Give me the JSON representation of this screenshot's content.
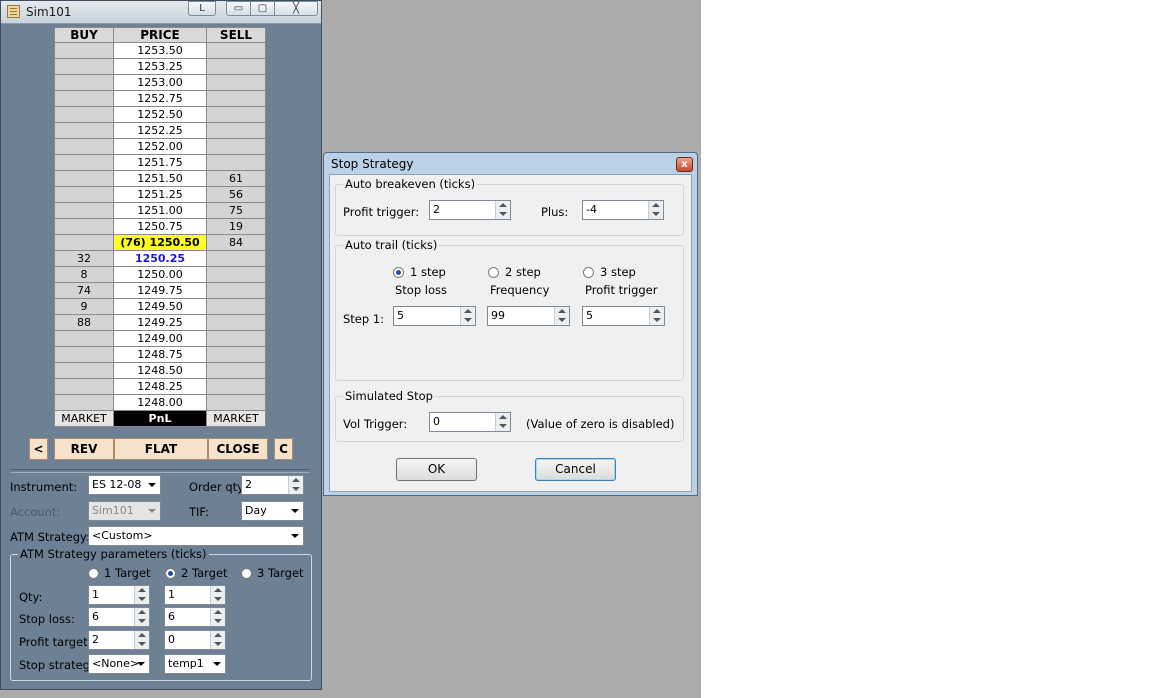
{
  "main_window": {
    "title": "Sim101",
    "title_buttons": {
      "layout": "L",
      "minimize": "▭",
      "maximize": "▢",
      "close": "╳"
    },
    "ladder": {
      "headers": {
        "buy": "BUY",
        "price": "PRICE",
        "sell": "SELL"
      },
      "rows": [
        {
          "buy": "",
          "price": "1253.50",
          "sell": ""
        },
        {
          "buy": "",
          "price": "1253.25",
          "sell": ""
        },
        {
          "buy": "",
          "price": "1253.00",
          "sell": ""
        },
        {
          "buy": "",
          "price": "1252.75",
          "sell": ""
        },
        {
          "buy": "",
          "price": "1252.50",
          "sell": ""
        },
        {
          "buy": "",
          "price": "1252.25",
          "sell": ""
        },
        {
          "buy": "",
          "price": "1252.00",
          "sell": ""
        },
        {
          "buy": "",
          "price": "1251.75",
          "sell": ""
        },
        {
          "buy": "",
          "price": "1251.50",
          "sell": "61"
        },
        {
          "buy": "",
          "price": "1251.25",
          "sell": "56"
        },
        {
          "buy": "",
          "price": "1251.00",
          "sell": "75"
        },
        {
          "buy": "",
          "price": "1250.75",
          "sell": "19"
        },
        {
          "buy": "",
          "price": "(76) 1250.50",
          "sell": "84",
          "style": "highlight"
        },
        {
          "buy": "32",
          "price": "1250.25",
          "sell": "",
          "style": "last"
        },
        {
          "buy": "8",
          "price": "1250.00",
          "sell": ""
        },
        {
          "buy": "74",
          "price": "1249.75",
          "sell": ""
        },
        {
          "buy": "9",
          "price": "1249.50",
          "sell": ""
        },
        {
          "buy": "88",
          "price": "1249.25",
          "sell": ""
        },
        {
          "buy": "",
          "price": "1249.00",
          "sell": ""
        },
        {
          "buy": "",
          "price": "1248.75",
          "sell": ""
        },
        {
          "buy": "",
          "price": "1248.50",
          "sell": ""
        },
        {
          "buy": "",
          "price": "1248.25",
          "sell": ""
        },
        {
          "buy": "",
          "price": "1248.00",
          "sell": ""
        }
      ],
      "footer": {
        "buy_market": "MARKET",
        "pnl": "PnL",
        "sell_market": "MARKET"
      }
    },
    "action_buttons": {
      "left": "<",
      "rev": "REV",
      "flat": "FLAT",
      "close": "CLOSE",
      "right": "C"
    },
    "form": {
      "instrument_label": "Instrument:",
      "instrument_value": "ES 12-08",
      "order_qty_label": "Order qty:",
      "order_qty_value": "2",
      "account_label": "Account:",
      "account_value": "Sim101",
      "tif_label": "TIF:",
      "tif_value": "Day",
      "atm_label": "ATM Strategy:",
      "atm_value": "<Custom>"
    },
    "atm_params": {
      "title": "ATM Strategy parameters (ticks)",
      "target_options": [
        "1 Target",
        "2 Target",
        "3 Target"
      ],
      "selected_target": 1,
      "qty_label": "Qty:",
      "qty_values": [
        "1",
        "1"
      ],
      "stop_loss_label": "Stop loss:",
      "stop_loss_values": [
        "6",
        "6"
      ],
      "profit_target_label": "Profit target:",
      "profit_target_values": [
        "2",
        "0"
      ],
      "stop_strategy_label": "Stop strategy:",
      "stop_strategy_values": [
        "<None>",
        "temp1"
      ]
    }
  },
  "stop_dialog": {
    "title": "Stop Strategy",
    "close_glyph": "x",
    "auto_breakeven": {
      "title": "Auto breakeven (ticks)",
      "profit_trigger_label": "Profit trigger:",
      "profit_trigger_value": "2",
      "plus_label": "Plus:",
      "plus_value": "-4"
    },
    "auto_trail": {
      "title": "Auto trail (ticks)",
      "step_options": [
        "1 step",
        "2 step",
        "3 step"
      ],
      "selected_step": 0,
      "col_headers": [
        "Stop loss",
        "Frequency",
        "Profit trigger"
      ],
      "step1_label": "Step 1:",
      "step1_values": [
        "5",
        "99",
        "5"
      ]
    },
    "simulated_stop": {
      "title": "Simulated Stop",
      "vol_trigger_label": "Vol Trigger:",
      "vol_trigger_value": "0",
      "note": "(Value of zero is disabled)"
    },
    "ok_label": "OK",
    "cancel_label": "Cancel"
  }
}
